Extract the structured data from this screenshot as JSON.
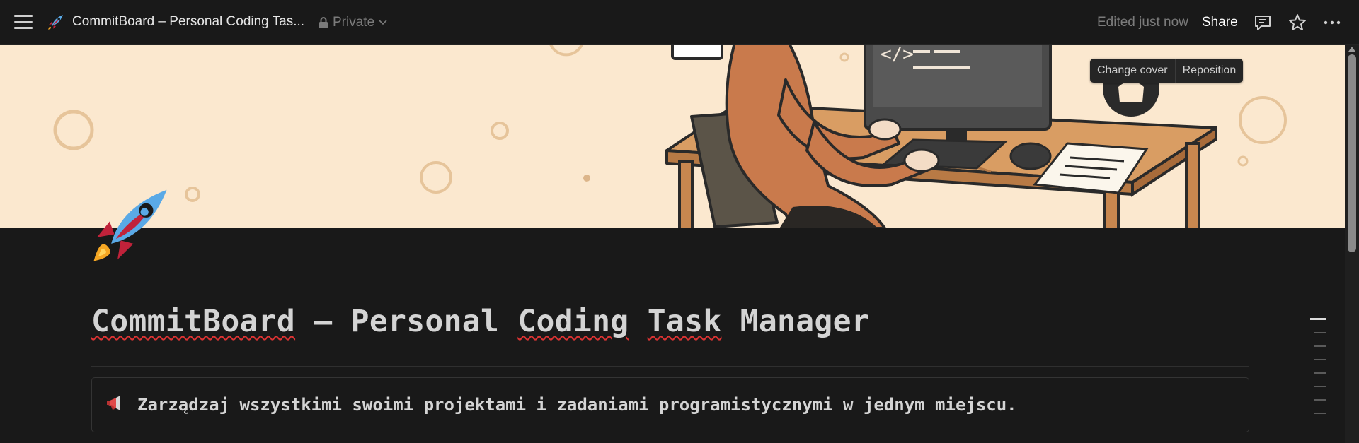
{
  "topbar": {
    "title": "CommitBoard – Personal Coding Tas...",
    "privacy": "Private",
    "edited": "Edited just now",
    "share": "Share",
    "icons": [
      "menu-icon",
      "rocket-icon",
      "lock-icon",
      "chevron-down-icon",
      "comment-icon",
      "star-icon",
      "more-icon"
    ]
  },
  "cover": {
    "change_cover": "Change cover",
    "reposition": "Reposition",
    "colors": {
      "background": "#fbe8cf",
      "accent": "#c97a4c"
    }
  },
  "page": {
    "title_part1": "CommitBoard",
    "title_part2": " – Personal ",
    "title_part3": "Coding",
    "title_part4": " ",
    "title_part5": "Task",
    "title_part6": " Manager",
    "callout_text": "Zarządzaj wszystkimi swoimi projektami i zadaniami programistycznymi w jednym miejscu."
  },
  "theme": {
    "background": "#191919",
    "text": "#d4d4d4",
    "muted": "#7b7b7b"
  }
}
